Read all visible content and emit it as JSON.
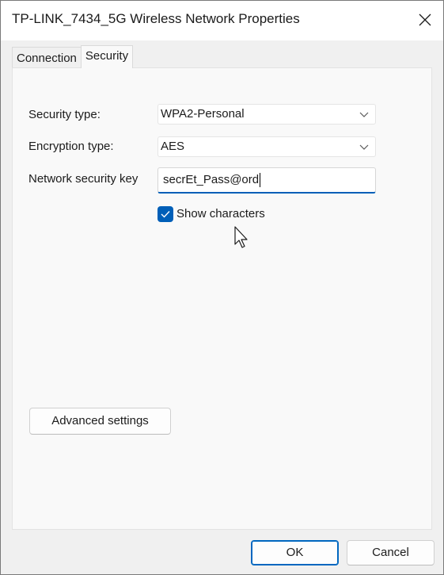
{
  "window": {
    "title": "TP-LINK_7434_5G Wireless Network Properties",
    "close_icon": "close-icon"
  },
  "tabs": [
    {
      "label": "Connection",
      "active": false
    },
    {
      "label": "Security",
      "active": true
    }
  ],
  "security": {
    "security_type_label": "Security type:",
    "security_type_value": "WPA2-Personal",
    "encryption_type_label": "Encryption type:",
    "encryption_type_value": "AES",
    "network_key_label": "Network security key",
    "network_key_value": "secrEt_Pass@ord",
    "show_characters_label": "Show characters",
    "show_characters_checked": true,
    "advanced_settings_label": "Advanced settings"
  },
  "footer": {
    "ok_label": "OK",
    "cancel_label": "Cancel"
  },
  "colors": {
    "accent": "#005fb8",
    "window_bg": "#f0f0f0",
    "panel_bg": "#f9f9f9"
  }
}
